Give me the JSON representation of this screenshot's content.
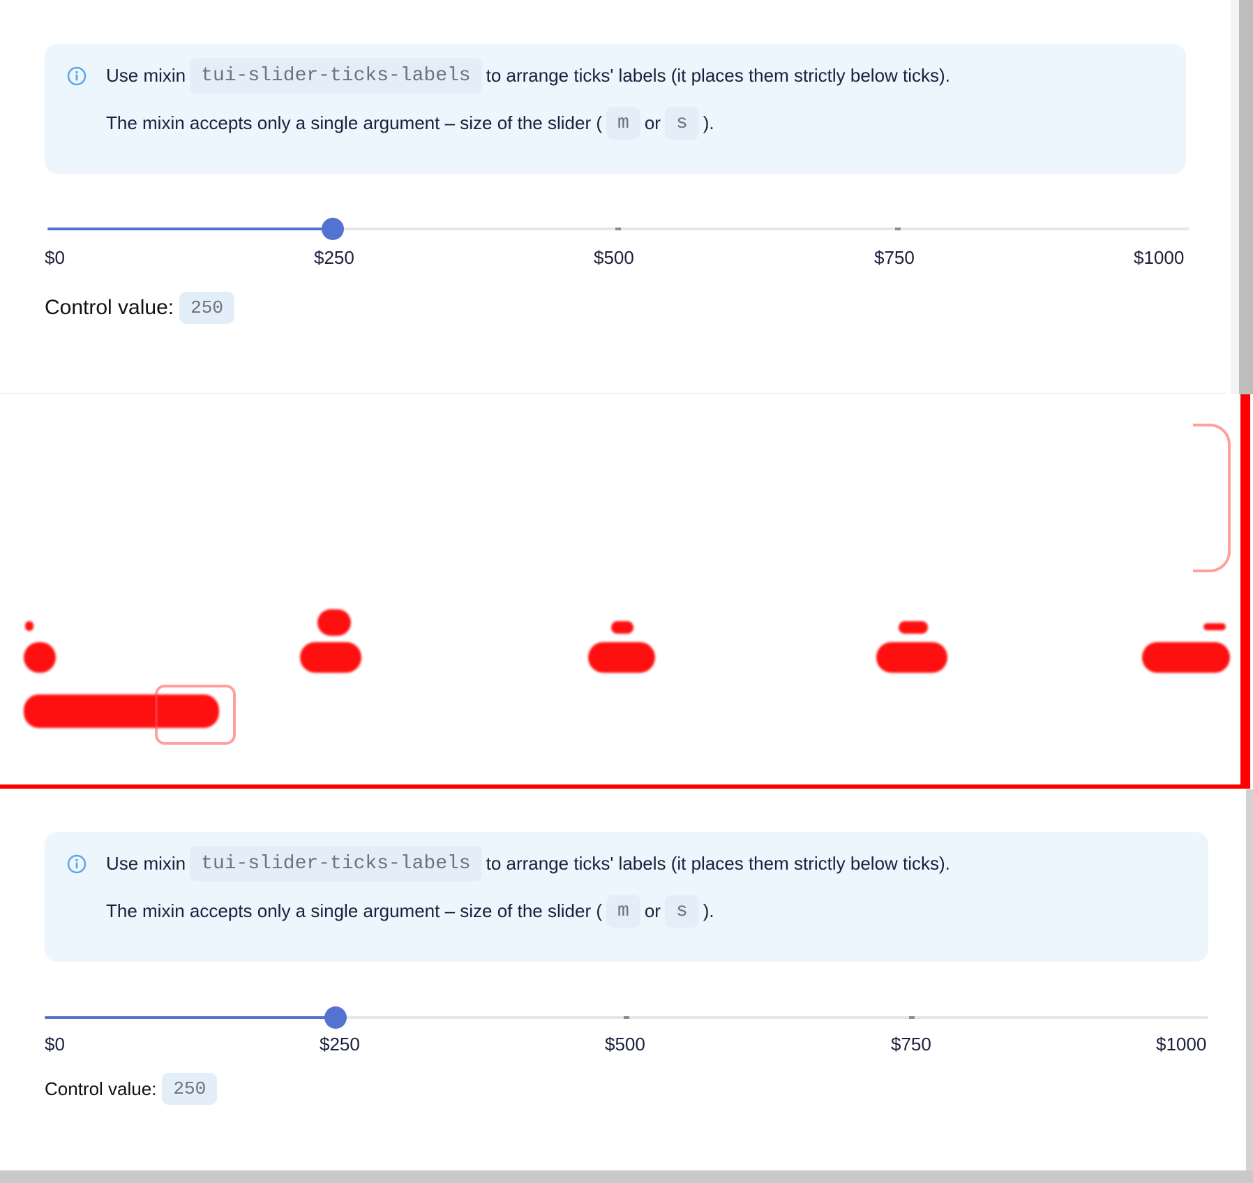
{
  "notice": {
    "line1_pre": "Use mixin",
    "mixin_name": "tui-slider-ticks-labels",
    "line1_post": "to arrange ticks' labels (it places them strictly below ticks).",
    "line2_pre": "The mixin accepts only a single argument – size of the slider (",
    "size_m": "m",
    "or": "or",
    "size_s": "s",
    "line2_post": ")."
  },
  "slider": {
    "min": 0,
    "max": 1000,
    "value": 250,
    "tick_labels": [
      "$0",
      "$250",
      "$500",
      "$750",
      "$1000"
    ]
  },
  "control": {
    "label": "Control value:",
    "value": "250"
  },
  "colors": {
    "accent": "#5473d0",
    "notice_bg": "#edf5fd",
    "glitch": "#ff0000"
  },
  "icons": {
    "info": "info-circle-icon"
  }
}
